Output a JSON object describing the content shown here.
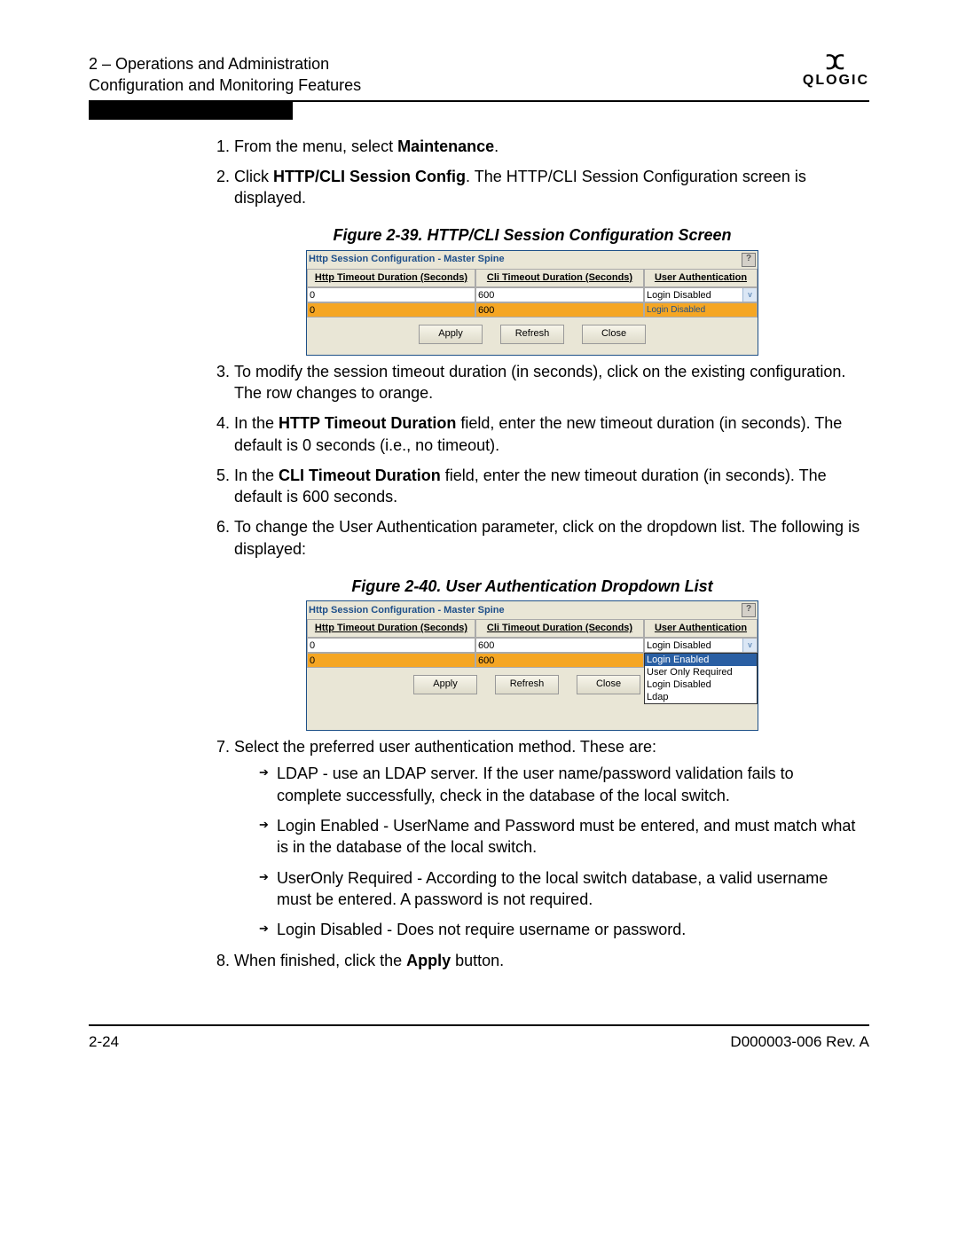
{
  "header": {
    "line1": "2 – Operations and Administration",
    "line2": "Configuration and Monitoring Features",
    "brand": "QLOGIC"
  },
  "steps": {
    "s1_a": "From the menu, select ",
    "s1_b": "Maintenance",
    "s1_c": ".",
    "s2_a": "Click ",
    "s2_b": "HTTP/CLI Session Config",
    "s2_c": ". The HTTP/CLI Session Configuration screen is displayed.",
    "s3": "To modify the session timeout duration (in seconds), click on the existing configuration. The row changes to orange.",
    "s4_a": "In the ",
    "s4_b": "HTTP Timeout Duration",
    "s4_c": " field, enter the new timeout duration (in seconds). The default is 0 seconds (i.e., no timeout).",
    "s5_a": "In the ",
    "s5_b": "CLI Timeout Duration",
    "s5_c": " field, enter the new timeout duration (in seconds). The default is 600 seconds.",
    "s6": "To change the User Authentication parameter, click on the dropdown list. The following is displayed:",
    "s7": "Select the preferred user authentication method. These are:",
    "s8_a": "When finished, click the ",
    "s8_b": "Apply",
    "s8_c": " button."
  },
  "bullets": {
    "b1": "LDAP - use an LDAP server. If the user name/password validation fails to complete successfully, check in the database of the local switch.",
    "b2": "Login Enabled - UserName and Password must be entered, and must match what is in the database of the local switch.",
    "b3": "UserOnly Required - According to the local switch database, a valid username must be entered.   A password is not required.",
    "b4": "Login Disabled - Does not require username or password."
  },
  "fig39": {
    "caption": "Figure 2-39. HTTP/CLI Session Configuration Screen",
    "title": "Http Session Configuration - Master Spine",
    "help": "?",
    "col1": "Http Timeout Duration (Seconds)",
    "col2": "Cli Timeout Duration (Seconds)",
    "col3": "User Authentication",
    "r1c1": "0",
    "r1c2": "600",
    "r1c3": "Login Disabled",
    "r2c1": "0",
    "r2c2": "600",
    "r2c3": "Login Disabled",
    "btn1": "Apply",
    "btn2": "Refresh",
    "btn3": "Close"
  },
  "fig40": {
    "caption": "Figure 2-40. User Authentication Dropdown List",
    "title": "Http Session Configuration - Master Spine",
    "help": "?",
    "col1": "Http Timeout Duration (Seconds)",
    "col2": "Cli Timeout Duration (Seconds)",
    "col3": "User Authentication",
    "r1c1": "0",
    "r1c2": "600",
    "r1c3": "Login Disabled",
    "r2c1": "0",
    "r2c2": "600",
    "opt1": "Login Enabled",
    "opt2": "User Only Required",
    "opt3": "Login Disabled",
    "opt4": "Ldap",
    "btn1": "Apply",
    "btn2": "Refresh",
    "btn3": "Close"
  },
  "footer": {
    "left": "2-24",
    "right": "D000003-006 Rev. A"
  }
}
